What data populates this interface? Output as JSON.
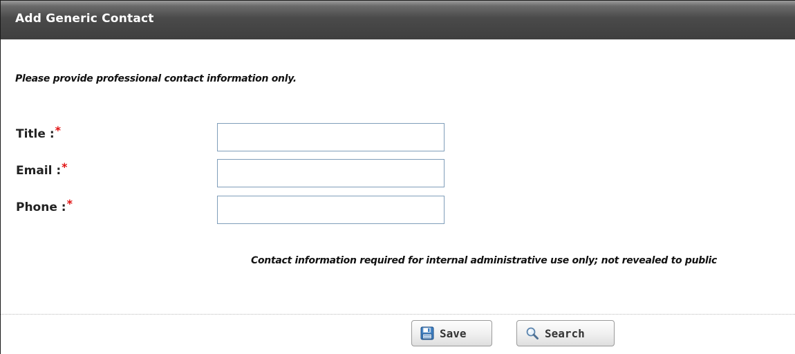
{
  "panel": {
    "title": "Add Generic Contact"
  },
  "notice": "Please provide professional contact information only.",
  "form": {
    "required_marker": "*",
    "fields": [
      {
        "label": "Title :",
        "value": "",
        "placeholder": ""
      },
      {
        "label": "Email :",
        "value": "",
        "placeholder": ""
      },
      {
        "label": "Phone :",
        "value": "",
        "placeholder": ""
      }
    ]
  },
  "privacy_note": "Contact information required for internal administrative use only; not revealed to public",
  "buttons": {
    "save_label": "Save",
    "save_icon": "floppy-disk-icon",
    "search_label": "Search",
    "search_icon": "magnifier-icon"
  },
  "colors": {
    "header_dark": "#3f3f3f",
    "header_light": "#9c9c9c",
    "required_red": "#e11111",
    "input_border": "#7f9db9"
  }
}
